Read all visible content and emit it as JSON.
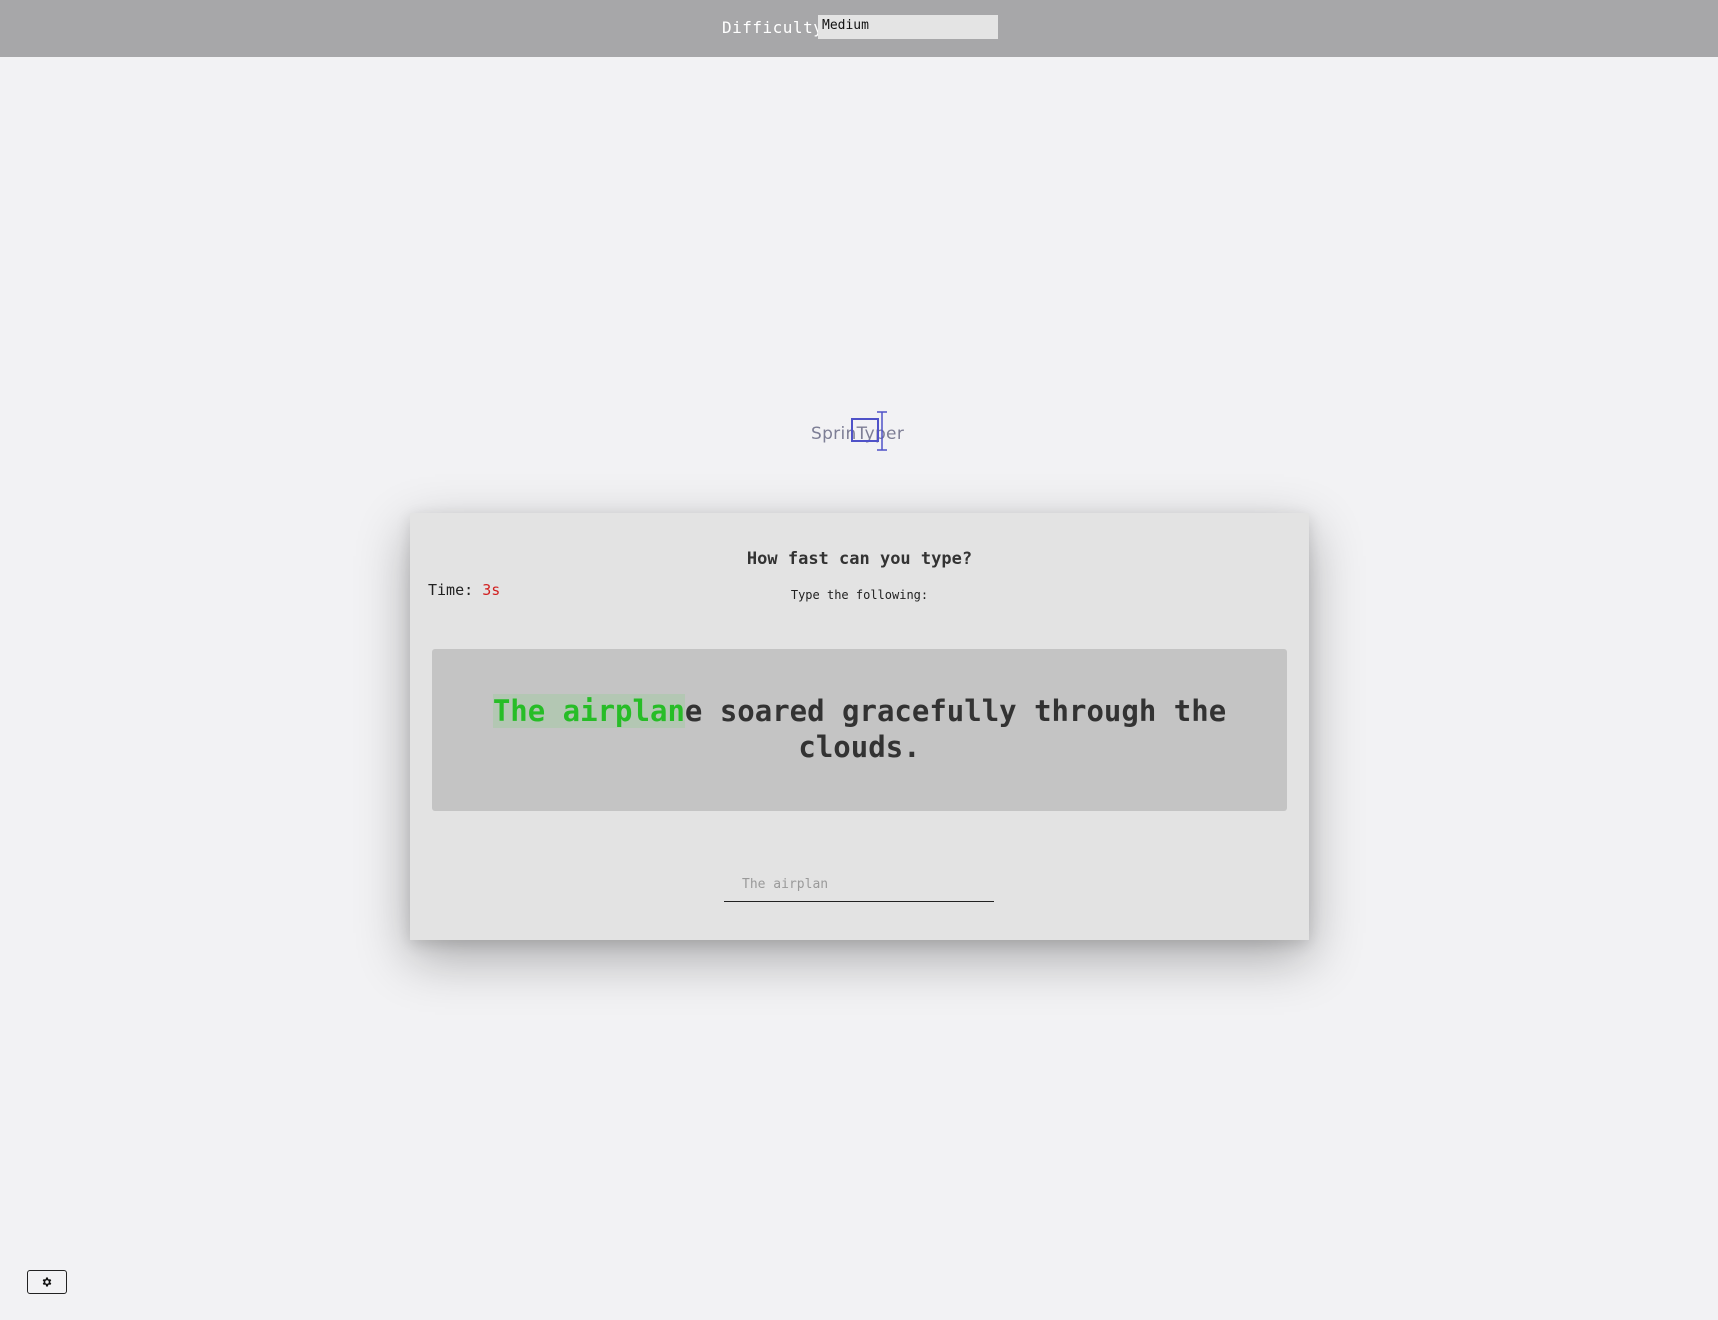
{
  "topbar": {
    "difficulty_label": "Difficulty",
    "difficulty_value": "Medium"
  },
  "logo": {
    "text": "SprinTyper"
  },
  "card": {
    "title": "How fast can you type?",
    "timer_label": "Time:",
    "timer_value": "3s",
    "subtitle": "Type the following:",
    "prompt_typed": "The airplan",
    "prompt_remaining": "e soared gracefully through the clouds."
  },
  "input": {
    "placeholder": "The airplan",
    "value": ""
  },
  "settings": {
    "icon": "gear-icon"
  },
  "colors": {
    "typed_text": "#27bd27",
    "typed_highlight": "#b3c7b3",
    "timer": "#d11f1f",
    "topbar": "#a7a7a9",
    "logo_accent": "#4f52c8"
  }
}
